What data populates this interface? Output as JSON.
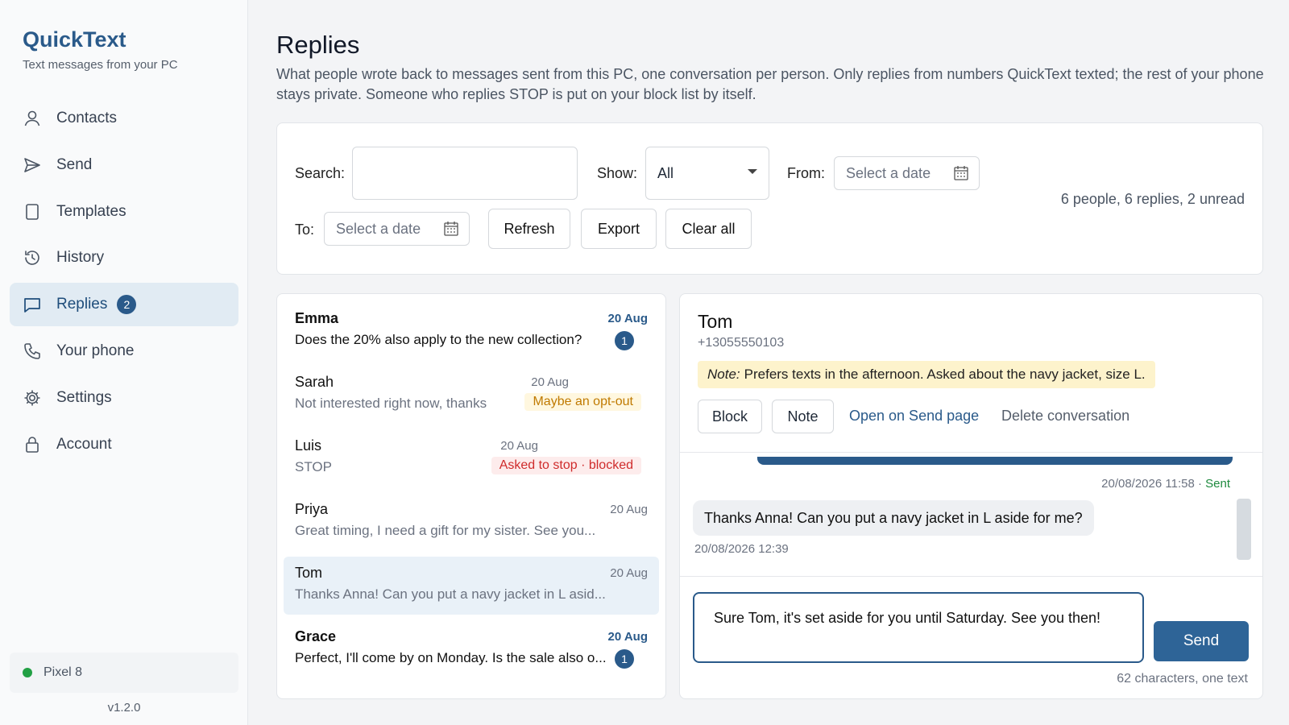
{
  "app": {
    "name": "QuickText",
    "tagline": "Text messages from your PC",
    "version": "v1.2.0",
    "device": "Pixel 8"
  },
  "nav": {
    "contacts": "Contacts",
    "send": "Send",
    "templates": "Templates",
    "history": "History",
    "replies": "Replies",
    "replies_badge": "2",
    "your_phone": "Your phone",
    "settings": "Settings",
    "account": "Account"
  },
  "page": {
    "title": "Replies",
    "description": "What people wrote back to messages sent from this PC, one conversation per person. Only replies from numbers QuickText texted; the rest of your phone stays private. Someone who replies STOP is put on your block list by itself."
  },
  "filters": {
    "search_label": "Search:",
    "search_value": "",
    "show_label": "Show:",
    "show_value": "All",
    "from_label": "From:",
    "from_placeholder": "Select a date",
    "to_label": "To:",
    "to_placeholder": "Select a date",
    "refresh": "Refresh",
    "export": "Export",
    "clear_all": "Clear all",
    "summary": "6 people, 6 replies, 2 unread"
  },
  "conversations": [
    {
      "name": "Emma",
      "preview": "Does the 20% also apply to the new collection?",
      "date": "20 Aug",
      "unread_count": "1"
    },
    {
      "name": "Sarah",
      "preview": "Not interested right now, thanks",
      "date": "20 Aug",
      "tag": "Maybe an opt-out"
    },
    {
      "name": "Luis",
      "preview": "STOP",
      "date": "20 Aug",
      "tag": "Asked to stop · blocked"
    },
    {
      "name": "Priya",
      "preview": "Great timing, I need a gift for my sister. See you...",
      "date": "20 Aug"
    },
    {
      "name": "Tom",
      "preview": "Thanks Anna! Can you put a navy jacket in L asid...",
      "date": "20 Aug"
    },
    {
      "name": "Grace",
      "preview": "Perfect, I'll come by on Monday. Is the sale also o...",
      "date": "20 Aug",
      "unread_count": "1"
    }
  ],
  "detail": {
    "name": "Tom",
    "phone": "+13055550103",
    "note_label": "Note:",
    "note_text": "Prefers texts in the afternoon. Asked about the navy jacket, size L.",
    "block": "Block",
    "note_button": "Note",
    "open_send": "Open on Send page",
    "delete": "Delete conversation",
    "outgoing_time": "20/08/2026 11:58 · ",
    "outgoing_status": "Sent",
    "incoming_text": "Thanks Anna! Can you put a navy jacket in L aside for me?",
    "incoming_time": "20/08/2026 12:39",
    "reply_text": "Sure Tom, it's set aside for you until Saturday. See you then!",
    "send": "Send",
    "char_count": "62 characters, one text"
  },
  "colors": {
    "accent": "#2a5a8a",
    "sent": "#1e8a3e",
    "warn": "#c07a00",
    "blocked": "#cf2b2b",
    "note_bg": "#fdf3cc"
  }
}
